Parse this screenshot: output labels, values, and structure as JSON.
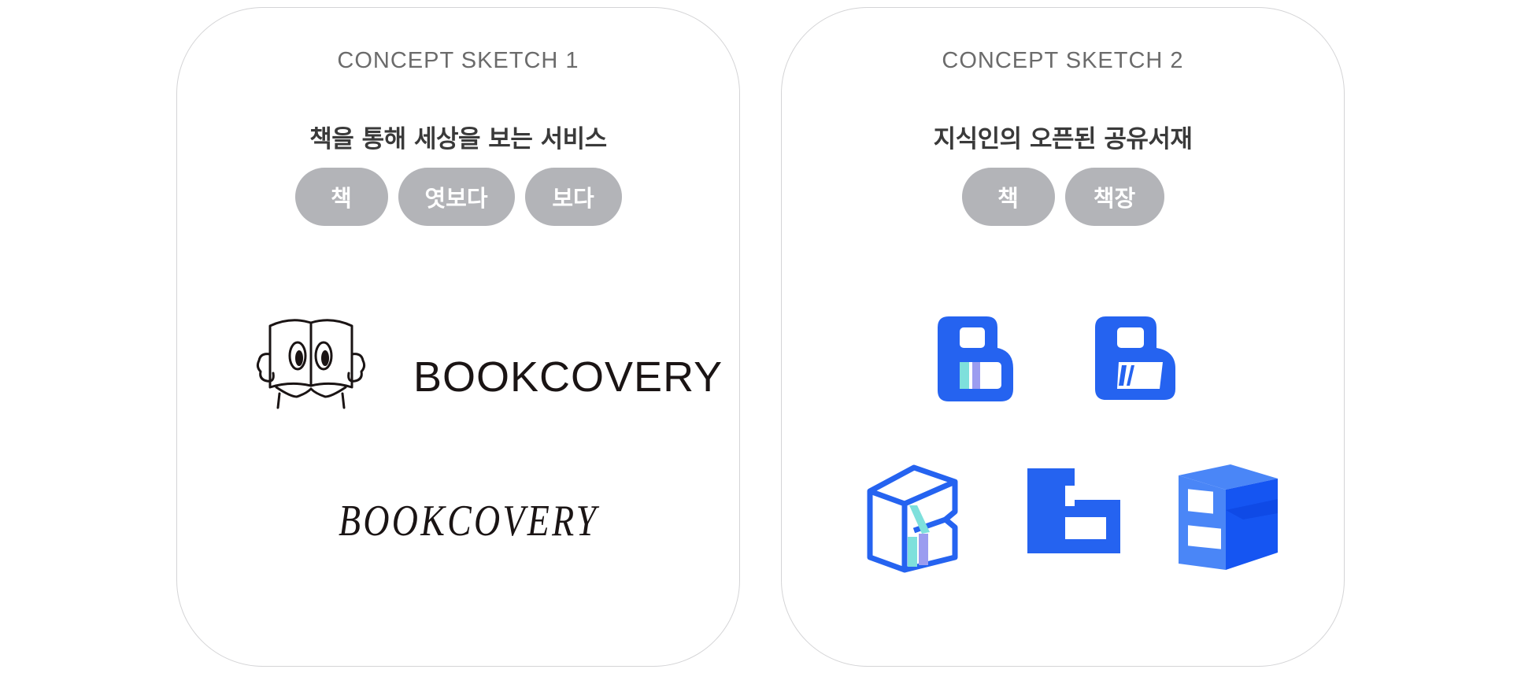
{
  "cards": [
    {
      "label": "CONCEPT SKETCH 1",
      "headline": "책을 통해 세상을 보는 서비스",
      "chips": [
        "책",
        "엿보다",
        "보다"
      ],
      "wordmark": "BOOKCOVERY",
      "wordmark_handwritten": "BOOKCOVERY"
    },
    {
      "label": "CONCEPT SKETCH 2",
      "headline": "지식인의 오픈된 공유서재",
      "chips": [
        "책",
        "책장"
      ]
    }
  ],
  "colors": {
    "chip_bg": "#b3b4b8",
    "brand_blue": "#2563f0",
    "accent_teal": "#7ee0dc",
    "accent_purple": "#9b9cf0",
    "ink": "#1a1414"
  },
  "icons": [
    "book-reader-mascot-icon",
    "b-logo-rounded-icon",
    "b-logo-rounded-slant-icon",
    "b-logo-cube-outline-icon",
    "b-logo-flat-icon",
    "b-logo-3d-icon"
  ]
}
